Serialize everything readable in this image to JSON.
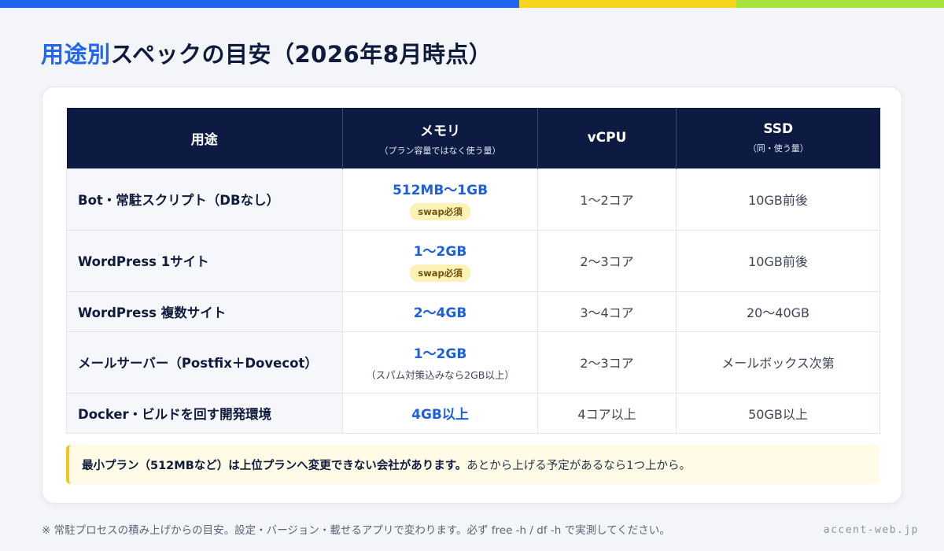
{
  "brand_colors": {
    "blue": "#2166ec",
    "yellow": "#f7d51d",
    "green": "#a6e33d",
    "navy": "#0d1b42"
  },
  "title": {
    "accent": "用途別",
    "rest": "スペックの目安（2026年8月時点）"
  },
  "table": {
    "headers": [
      {
        "label": "用途",
        "sub": ""
      },
      {
        "label": "メモリ",
        "sub": "（プラン容量ではなく使う量）"
      },
      {
        "label": "vCPU",
        "sub": ""
      },
      {
        "label": "SSD",
        "sub": "（同・使う量）"
      }
    ],
    "rows": [
      {
        "use": "Bot・常駐スクリプト（DBなし）",
        "memory": "512MB〜1GB",
        "badge": "swap必須",
        "note": "",
        "vcpu": "1〜2コア",
        "ssd": "10GB前後"
      },
      {
        "use": "WordPress 1サイト",
        "memory": "1〜2GB",
        "badge": "swap必須",
        "note": "",
        "vcpu": "2〜3コア",
        "ssd": "10GB前後"
      },
      {
        "use": "WordPress 複数サイト",
        "memory": "2〜4GB",
        "badge": "",
        "note": "",
        "vcpu": "3〜4コア",
        "ssd": "20〜40GB"
      },
      {
        "use": "メールサーバー（Postfix＋Dovecot）",
        "memory": "1〜2GB",
        "badge": "",
        "note": "（スパム対策込みなら2GB以上）",
        "vcpu": "2〜3コア",
        "ssd": "メールボックス次第"
      },
      {
        "use": "Docker・ビルドを回す開発環境",
        "memory": "4GB以上",
        "badge": "",
        "note": "",
        "vcpu": "4コア以上",
        "ssd": "50GB以上"
      }
    ]
  },
  "notice": {
    "strong": "最小プラン（512MBなど）は上位プランへ変更できない会社があります。",
    "rest": "あとから上げる予定があるなら1つ上から。"
  },
  "footnote": "※ 常駐プロセスの積み上げからの目安。設定・バージョン・載せるアプリで変わります。必ず free -h / df -h で実測してください。",
  "brand": "accent-web.jp"
}
